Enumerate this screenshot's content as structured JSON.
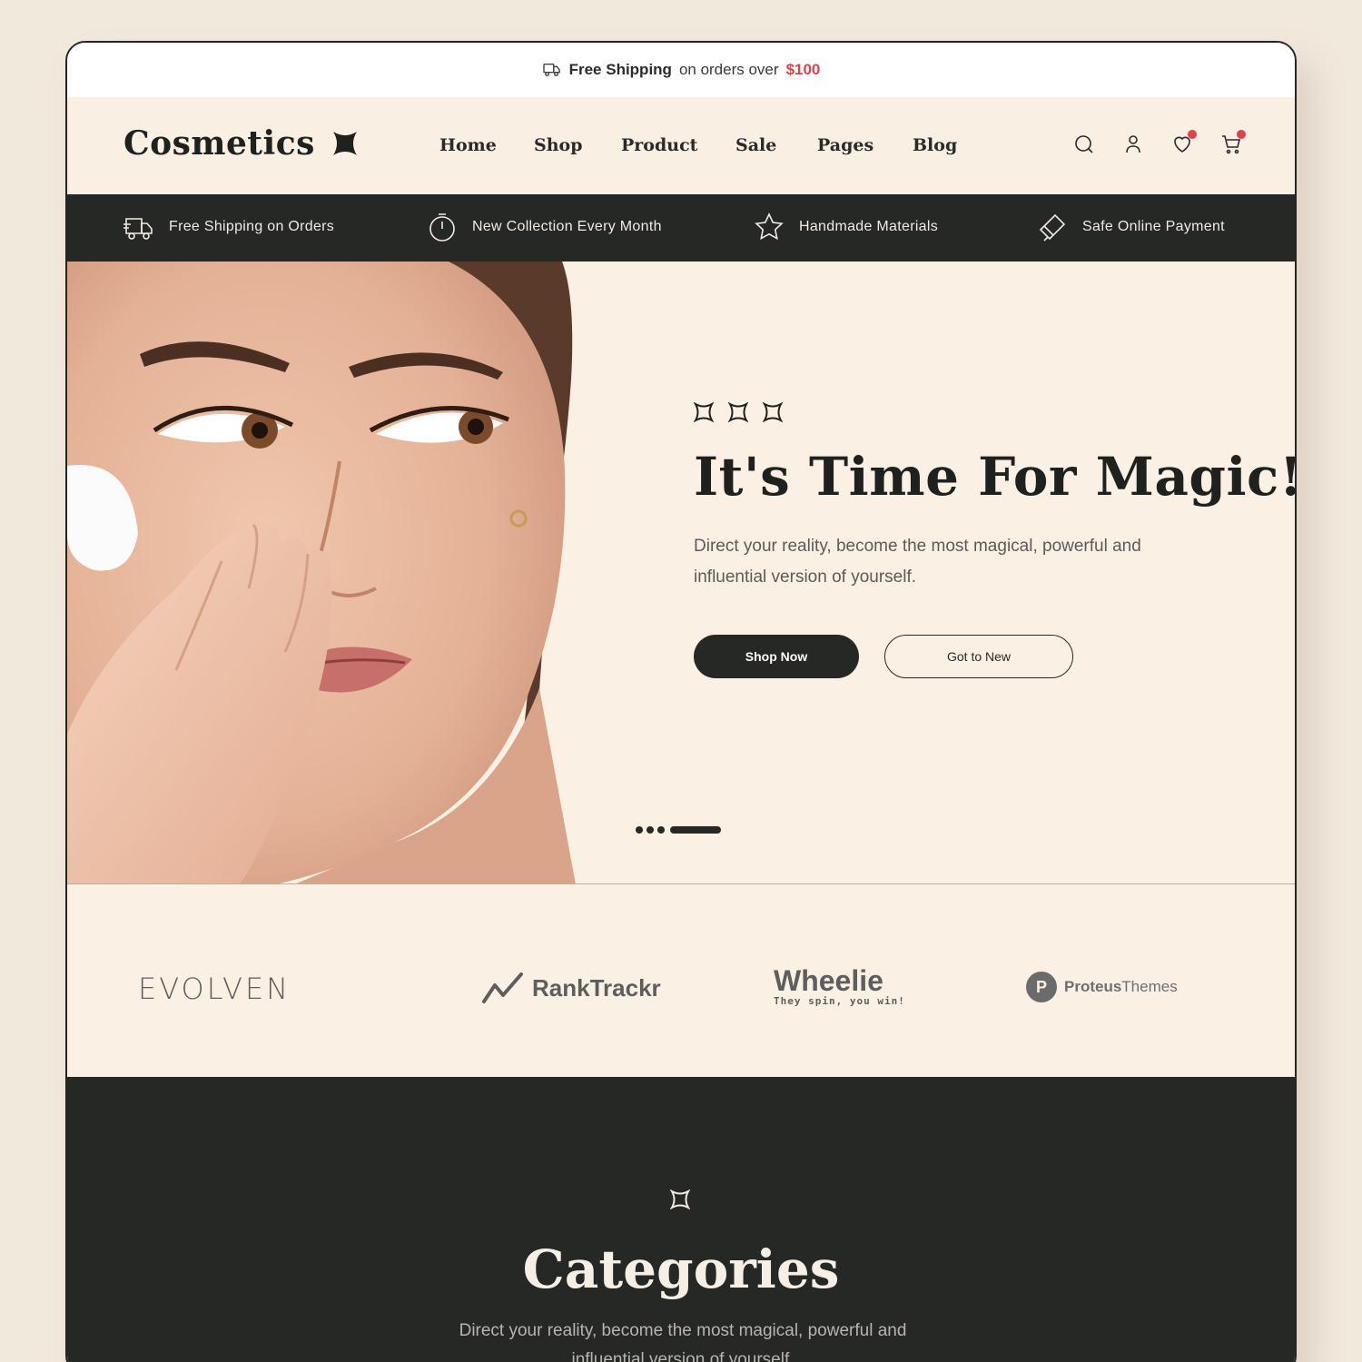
{
  "announcement": {
    "bold": "Free Shipping",
    "text": "on orders over",
    "price": "$100"
  },
  "brand": {
    "name": "Cosmetics"
  },
  "nav": [
    {
      "label": "Home"
    },
    {
      "label": "Shop"
    },
    {
      "label": "Product"
    },
    {
      "label": "Sale"
    },
    {
      "label": "Pages"
    },
    {
      "label": "Blog"
    }
  ],
  "header_icons": [
    "search-icon",
    "user-icon",
    "heart-icon",
    "cart-icon"
  ],
  "features": [
    {
      "icon": "truck-icon",
      "label": "Free Shipping on Orders"
    },
    {
      "icon": "stopwatch-icon",
      "label": "New Collection Every Month"
    },
    {
      "icon": "star-icon",
      "label": "Handmade  Materials"
    },
    {
      "icon": "card-icon",
      "label": "Safe Online Payment"
    }
  ],
  "hero": {
    "title": "It's Time For Magic!",
    "description": "Direct your reality, become the most magical, powerful and influential version of yourself.",
    "primary_button": "Shop Now",
    "secondary_button": "Got to New",
    "slide_count": 4,
    "active_slide": 4
  },
  "brands": [
    {
      "name": "EVOLVEN"
    },
    {
      "name": "RankTrackr"
    },
    {
      "name": "Wheelie",
      "tagline": "They spin, you win!"
    },
    {
      "name_bold": "Proteus",
      "name_light": "Themes"
    }
  ],
  "categories": {
    "title": "Categories",
    "description": "Direct your reality, become the most magical, powerful and influential version of yourself."
  },
  "colors": {
    "dark": "#262825",
    "cream": "#faf0e4",
    "accent": "#e0414a",
    "page_bg": "#f2e9dd"
  }
}
